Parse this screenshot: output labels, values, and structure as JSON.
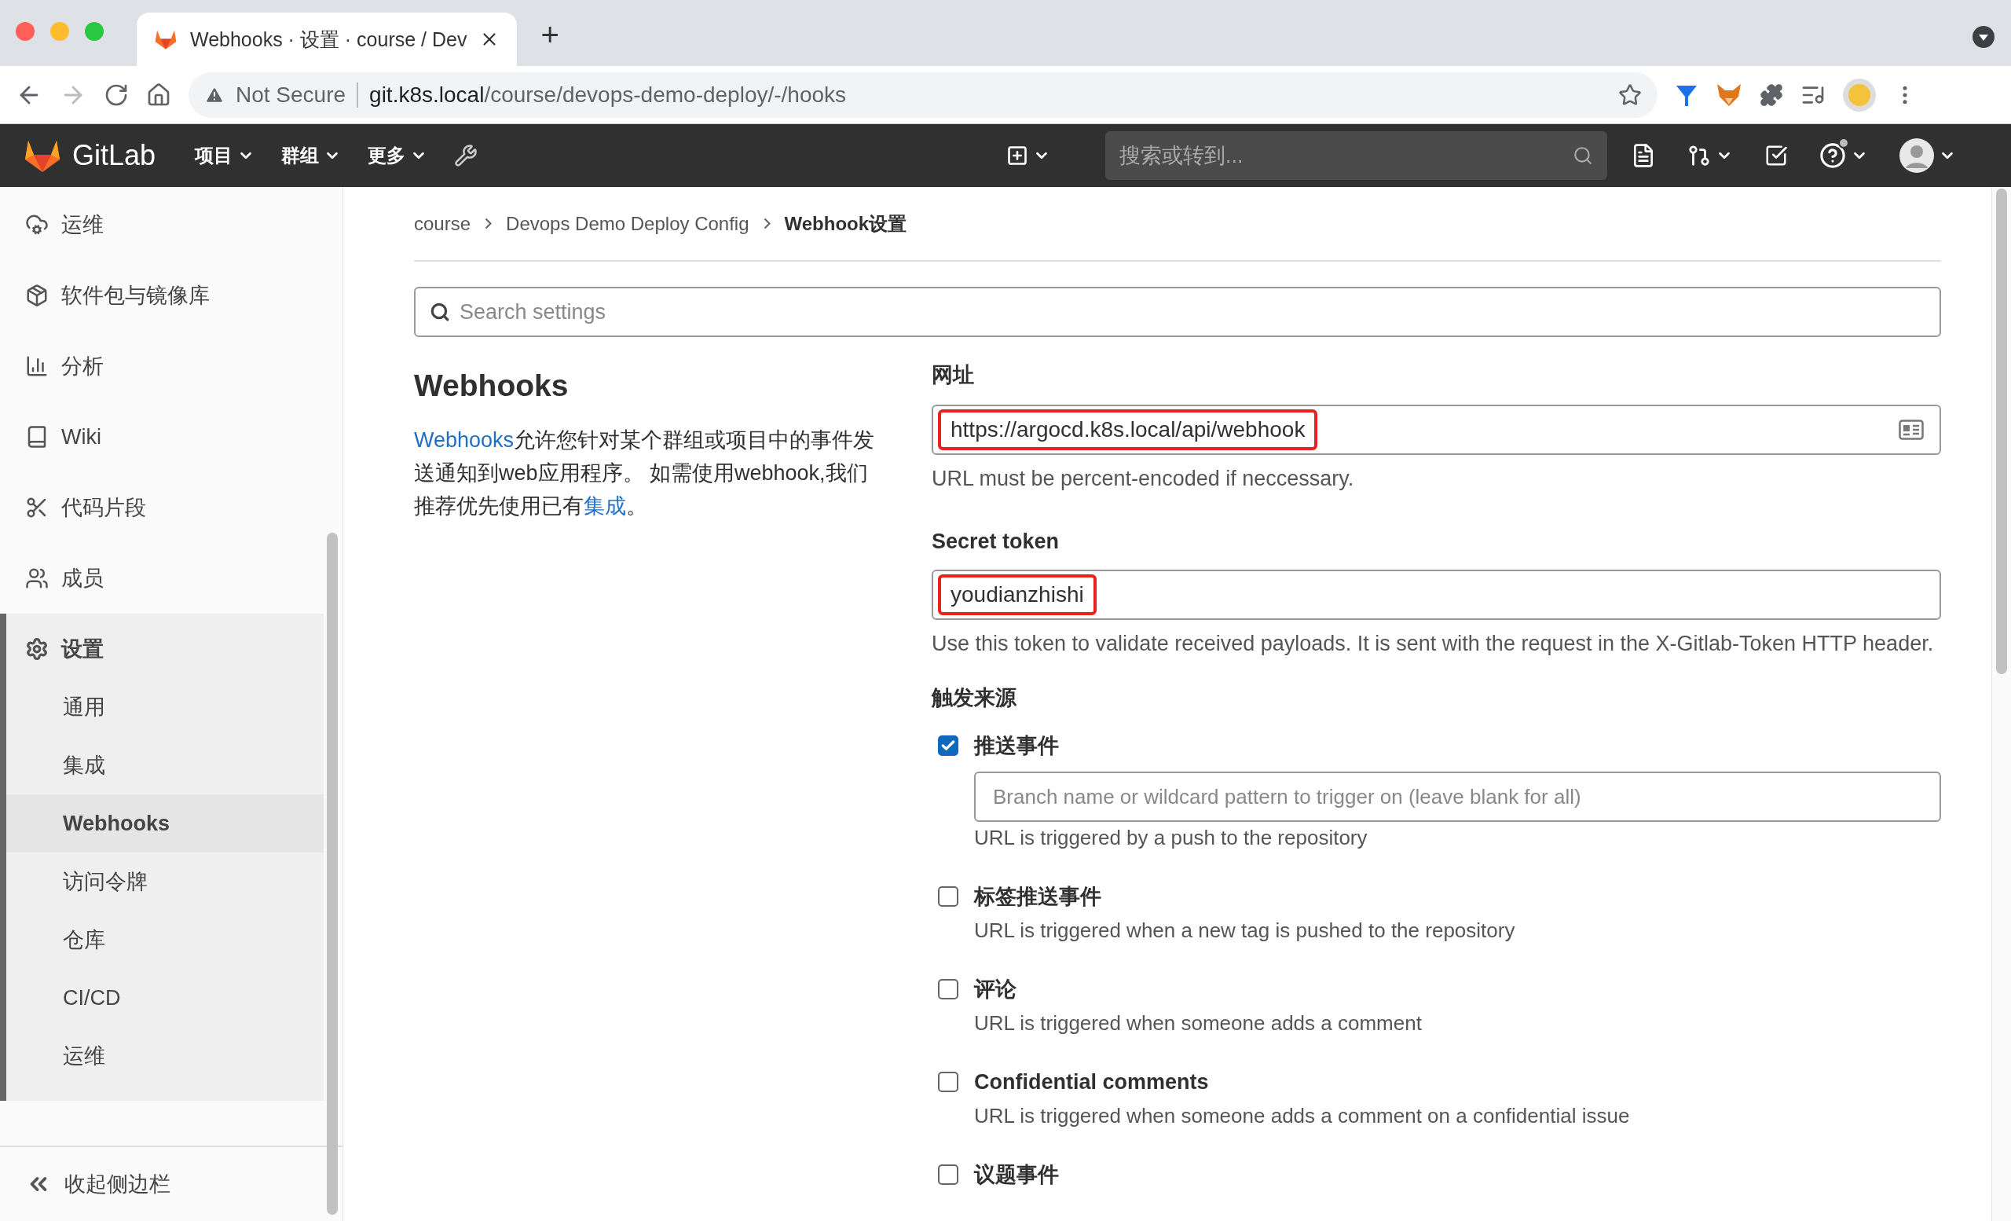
{
  "browser": {
    "tab": {
      "title": "Webhooks · 设置 · course / Dev"
    },
    "new_tab": "+",
    "address": {
      "warning": "Not Secure",
      "host": "git.k8s.local",
      "path": "/course/devops-demo-deploy/-/hooks"
    }
  },
  "navbar": {
    "brand": "GitLab",
    "menus": [
      "项目",
      "群组",
      "更多"
    ],
    "search": {
      "placeholder": "搜索或转到..."
    }
  },
  "sidebar": {
    "items": [
      {
        "label": "运维",
        "active": false
      },
      {
        "label": "软件包与镜像库",
        "active": false
      },
      {
        "label": "分析",
        "active": false
      },
      {
        "label": "Wiki",
        "active": false
      },
      {
        "label": "代码片段",
        "active": false
      },
      {
        "label": "成员",
        "active": false
      },
      {
        "label": "设置",
        "active": true,
        "children": [
          {
            "label": "通用",
            "selected": false
          },
          {
            "label": "集成",
            "selected": false
          },
          {
            "label": "Webhooks",
            "selected": true
          },
          {
            "label": "访问令牌",
            "selected": false
          },
          {
            "label": "仓库",
            "selected": false
          },
          {
            "label": "CI/CD",
            "selected": false
          },
          {
            "label": "运维",
            "selected": false
          }
        ]
      }
    ],
    "collapse": "收起侧边栏"
  },
  "breadcrumb": [
    "course",
    "Devops Demo Deploy Config",
    "Webhook设置"
  ],
  "search_settings": {
    "placeholder": "Search settings"
  },
  "section": {
    "title": "Webhooks",
    "description": [
      {
        "text": "Webhooks",
        "link": true
      },
      {
        "text": "允许您针对某个群组或项目中的事件发送通知到web应用程序。 如需使用webhook,我们推荐优先使用已有",
        "link": false
      },
      {
        "text": "集成",
        "link": true
      },
      {
        "text": "。",
        "link": false
      }
    ]
  },
  "form": {
    "url": {
      "label": "网址",
      "value": "https://argocd.k8s.local/api/webhook",
      "annotated": true,
      "help": "URL must be percent-encoded if neccessary."
    },
    "token": {
      "label": "Secret token",
      "value": "youdianzhishi",
      "annotated": true,
      "help": "Use this token to validate received payloads. It is sent with the request in the X-Gitlab-Token HTTP header."
    },
    "triggers": {
      "label": "触发来源",
      "items": [
        {
          "label": "推送事件",
          "checked": true,
          "branch_filter": {
            "placeholder": "Branch name or wildcard pattern to trigger on (leave blank for all)"
          },
          "help": "URL is triggered by a push to the repository"
        },
        {
          "label": "标签推送事件",
          "checked": false,
          "help": "URL is triggered when a new tag is pushed to the repository"
        },
        {
          "label": "评论",
          "checked": false,
          "help": "URL is triggered when someone adds a comment"
        },
        {
          "label": "Confidential comments",
          "checked": false,
          "help": "URL is triggered when someone adds a comment on a confidential issue"
        },
        {
          "label": "议题事件",
          "checked": false
        }
      ]
    }
  }
}
